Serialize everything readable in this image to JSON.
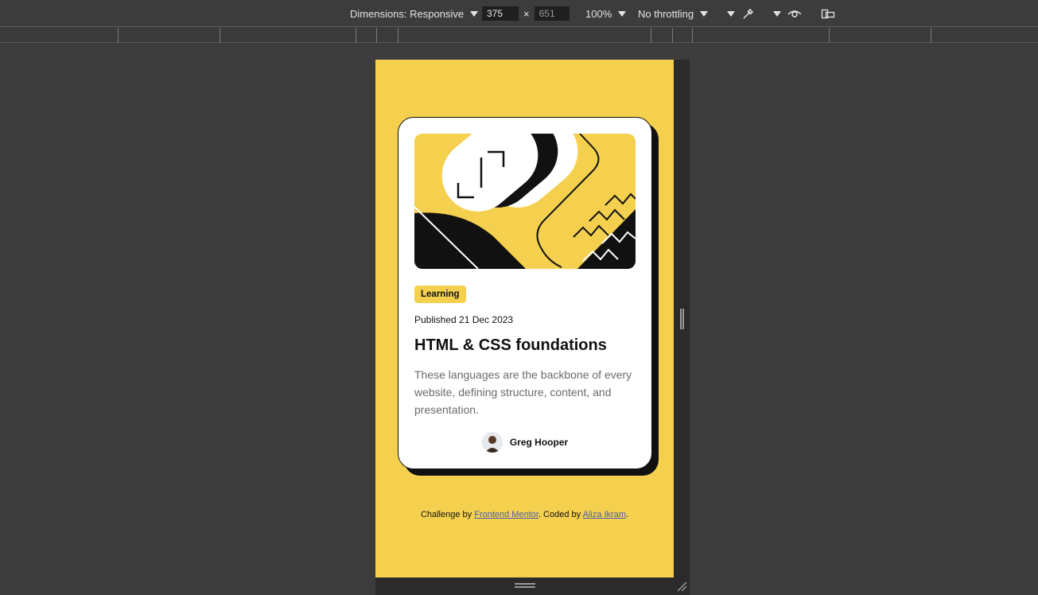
{
  "devtools": {
    "dimensions_label": "Dimensions: Responsive",
    "width_value": "375",
    "times": "×",
    "height_value": "651",
    "zoom": "100%",
    "throttling": "No throttling",
    "icons": [
      "eyedropper-icon",
      "eye-icon",
      "rotate-icon"
    ]
  },
  "card": {
    "badge": "Learning",
    "published": "Published 21 Dec 2023",
    "title": "HTML & CSS foundations",
    "description": "These languages are the backbone of every website, defining structure, content, and presentation.",
    "author": "Greg Hooper"
  },
  "attribution": {
    "prefix": "Challenge by ",
    "link1": "Frontend Mentor",
    "middle": ". Coded by ",
    "link2": "Aliza Ikram",
    "suffix": "."
  }
}
